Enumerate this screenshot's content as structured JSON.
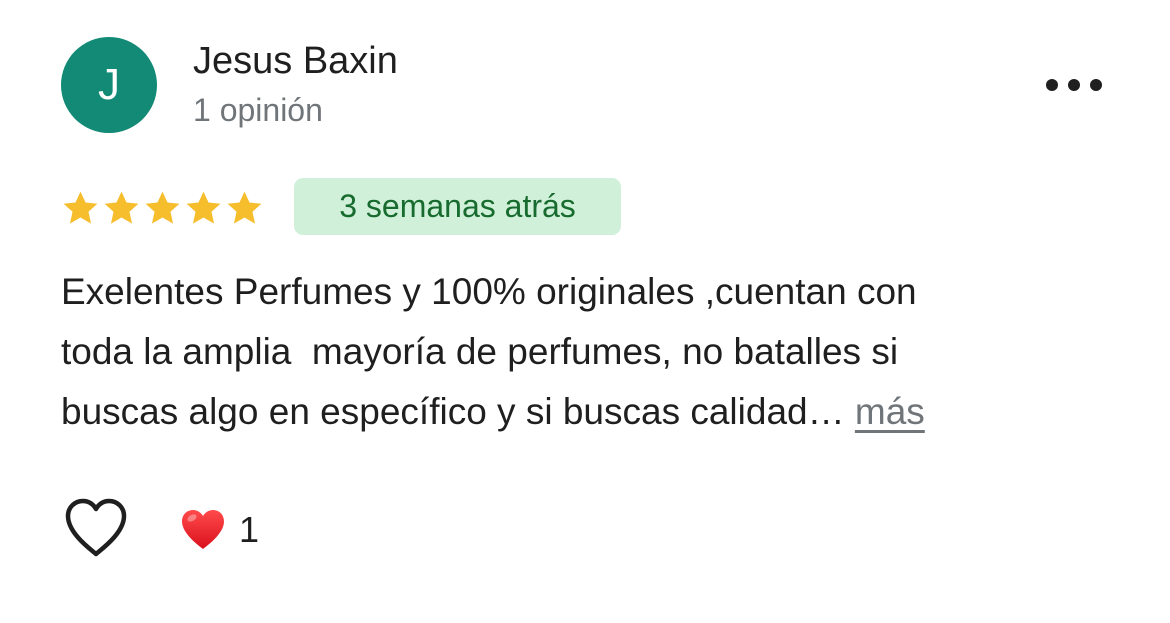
{
  "review": {
    "author": {
      "initial": "J",
      "name": "Jesus Baxin",
      "meta": "1 opinión",
      "avatar_color": "#128a76"
    },
    "rating": 5,
    "rating_max": 5,
    "star_color": "#f6bd2c",
    "date": "3 semanas atrás",
    "date_badge_bg": "#d0f0d9",
    "text_lines": [
      "Exelentes Perfumes y 100% originales ,cuentan con",
      "toda la amplia  mayoría de perfumes, no batalles si",
      "buscas algo en específico y si buscas calidad… "
    ],
    "more_label": "más",
    "reactions": {
      "like_icon": "heart-outline-icon",
      "emoji_icon": "red-heart-icon",
      "count": "1"
    },
    "menu_icon": "more-horizontal-icon"
  }
}
